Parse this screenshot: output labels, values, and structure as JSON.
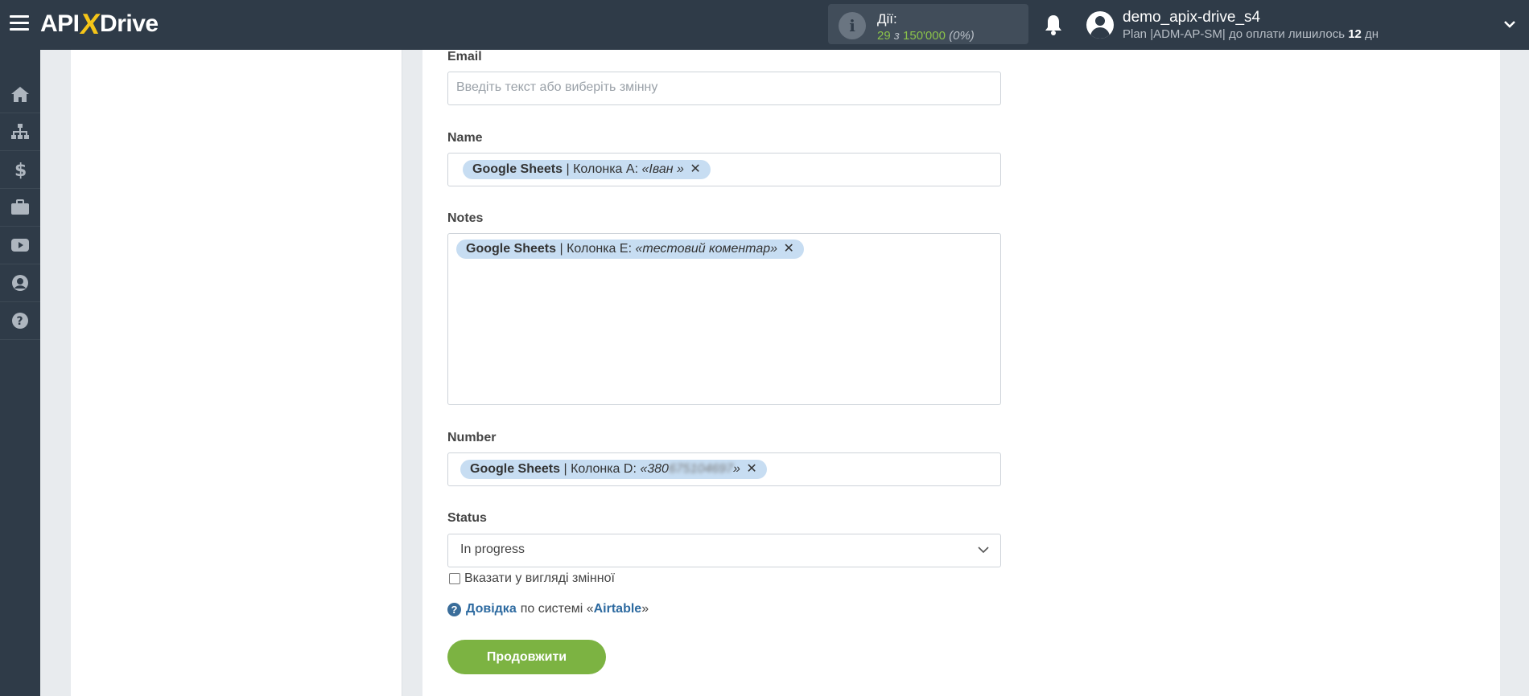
{
  "header": {
    "logo": {
      "left": "API",
      "x": "X",
      "right": "Drive"
    },
    "actions": {
      "label": "Дії:",
      "used": "29",
      "sep": "з",
      "limit": "150'000",
      "percent": "(0%)"
    },
    "user": {
      "name": "demo_apix-drive_s4",
      "plan_prefix": "Plan |ADM-AP-SM| до оплати лишилось",
      "days": "12",
      "days_suffix": "дн"
    }
  },
  "sidebar": {
    "items": [
      "home-icon",
      "sitemap-icon",
      "dollar-icon",
      "briefcase-icon",
      "youtube-icon",
      "user-icon",
      "help-icon"
    ]
  },
  "form": {
    "email": {
      "label": "Email",
      "placeholder": "Введіть текст або виберіть змінну"
    },
    "name": {
      "label": "Name",
      "chip": {
        "source": "Google Sheets",
        "column": "| Колонка А:",
        "value": "«Іван »",
        "remove": "✕"
      }
    },
    "notes": {
      "label": "Notes",
      "chip": {
        "source": "Google Sheets",
        "column": "| Колонка E:",
        "value": "«тестовий коментар»",
        "remove": "✕"
      }
    },
    "number": {
      "label": "Number",
      "chip": {
        "source": "Google Sheets",
        "column": "| Колонка D:",
        "value_visible": "«380",
        "value_blurred": "675104697",
        "value_end": "»",
        "remove": "✕"
      }
    },
    "status": {
      "label": "Status",
      "value": "In progress"
    },
    "as_variable": "Вказати у вигляді змінної",
    "help": {
      "link": "Довідка",
      "text": "по системі «",
      "system": "Airtable",
      "end": "»"
    },
    "continue": "Продовжити"
  },
  "colors": {
    "topbar": "#2f3b48",
    "accent_green": "#7cb342",
    "chip_bg": "#c7ddf2",
    "link_blue": "#2d6aa0"
  }
}
